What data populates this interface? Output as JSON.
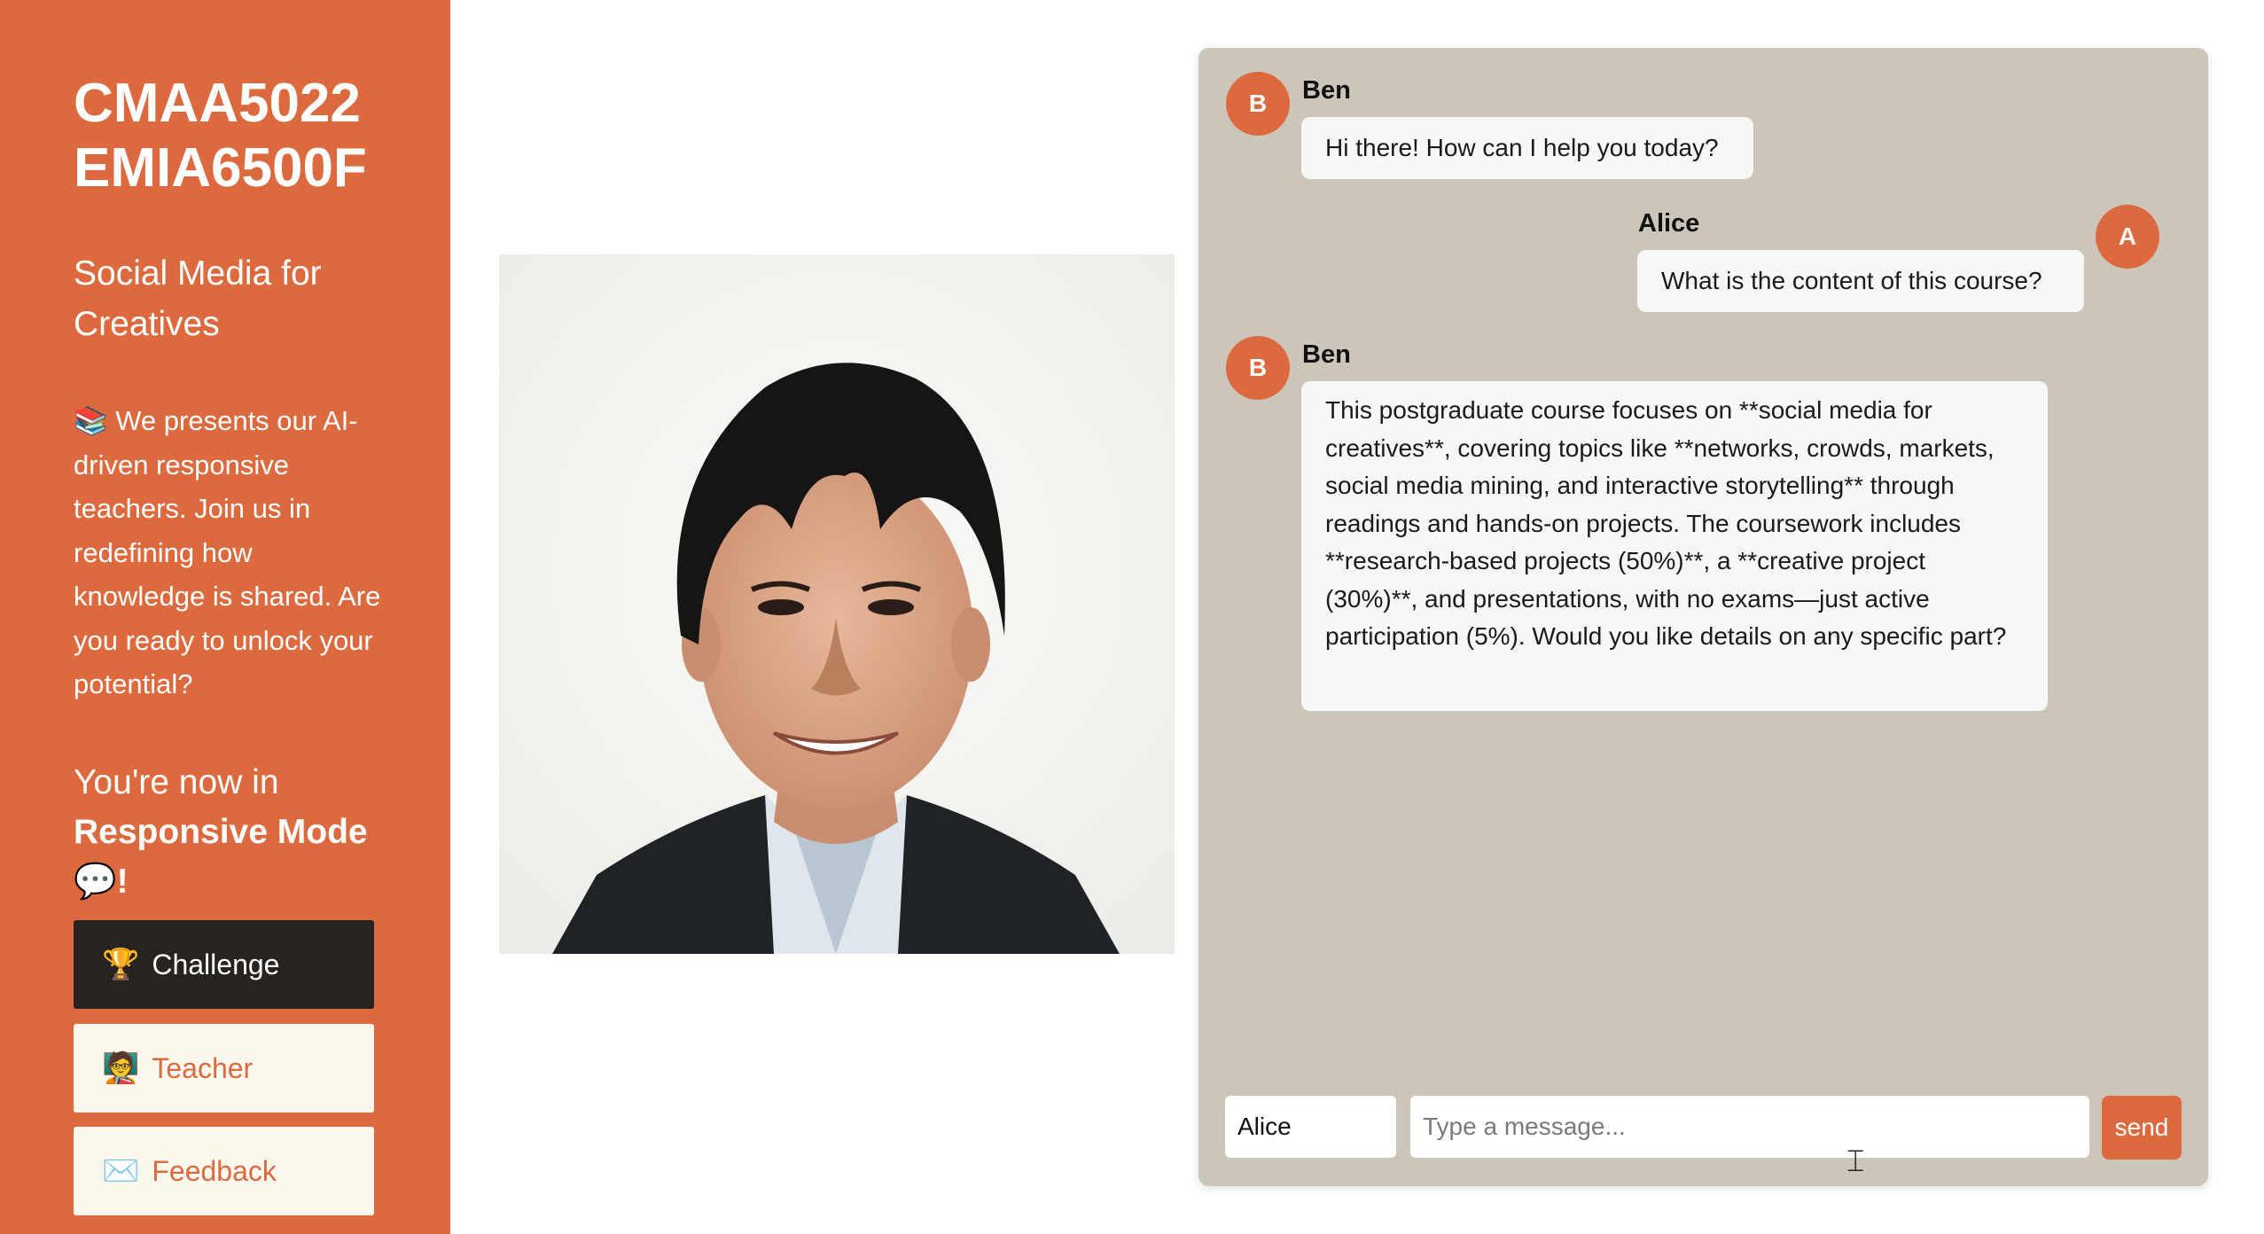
{
  "sidebar": {
    "course_code_1": "CMAA5022",
    "course_code_2": "EMIA6500F",
    "course_title": "Social Media for Creatives",
    "intro_icon": "📚",
    "intro_text": "We presents our AI-driven responsive teachers. Join us in redefining how knowledge is shared. Are you ready to unlock your potential?",
    "mode_prefix": "You're now in",
    "mode_name": "Responsive Mode",
    "mode_emoji": "💬",
    "mode_suffix": "!",
    "buttons": [
      {
        "icon": "trophy-icon",
        "glyph": "🏆",
        "label": "Challenge"
      },
      {
        "icon": "teacher-icon",
        "glyph": "🧑‍🏫",
        "label": "Teacher"
      },
      {
        "icon": "envelope-icon",
        "glyph": "✉️",
        "label": "Feedback"
      }
    ]
  },
  "chat": {
    "messages": [
      {
        "sender": "Ben",
        "initial": "B",
        "text": "Hi there! How can I help you today?"
      },
      {
        "sender": "Alice",
        "initial": "A",
        "text": "What is the content of this course?"
      },
      {
        "sender": "Ben",
        "initial": "B",
        "text": "This postgraduate course focuses on **social media for creatives**, covering topics like **networks, crowds, markets, social media mining, and interactive storytelling** through readings and hands-on projects. The coursework includes **research-based projects (50%)**, a **creative project (30%)**, and presentations, with no exams—just active participation (5%). Would you like details on any specific part?"
      }
    ],
    "name_value": "Alice",
    "message_placeholder": "Type a message...",
    "send_label": "send"
  },
  "colors": {
    "accent": "#dc6a3e",
    "sidebar_dark_button": "#262321",
    "chat_background": "#ccc5b9",
    "light_button": "#fdf8ee"
  }
}
